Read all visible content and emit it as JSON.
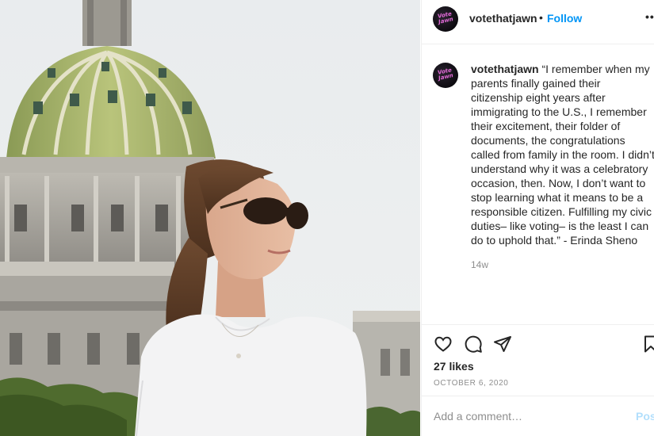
{
  "post": {
    "username": "votethatjawn",
    "dot": "•",
    "follow_label": "Follow",
    "more_label": "•••",
    "avatar_logo_top": "Vote",
    "avatar_logo_bottom": "Jawn",
    "caption": {
      "username": "votethatjawn",
      "text": "“I remember when my parents finally gained their citizenship eight years after immigrating to the U.S., I remember their excitement, their folder of documents, the congratulations called from family in the room. I didn’t understand why it was a celebratory occasion, then. Now, I don’t want to stop learning what it means to be a responsible citizen. Fulfilling my civic duties– like voting– is the least I can do to uphold that.” - Erinda Sheno"
    },
    "time_ago": "14w",
    "likes": "27 likes",
    "date": "OCTOBER 6, 2020"
  },
  "actions": {
    "like_icon": "heart-icon",
    "comment_icon": "comment-bubble-icon",
    "share_icon": "paper-plane-icon",
    "save_icon": "bookmark-icon"
  },
  "comment_box": {
    "placeholder": "Add a comment…",
    "post_label": "Post"
  },
  "colors": {
    "accent": "#0095f6",
    "post_disabled": "#b2dffc",
    "muted": "#8e8e8e",
    "text": "#262626"
  }
}
